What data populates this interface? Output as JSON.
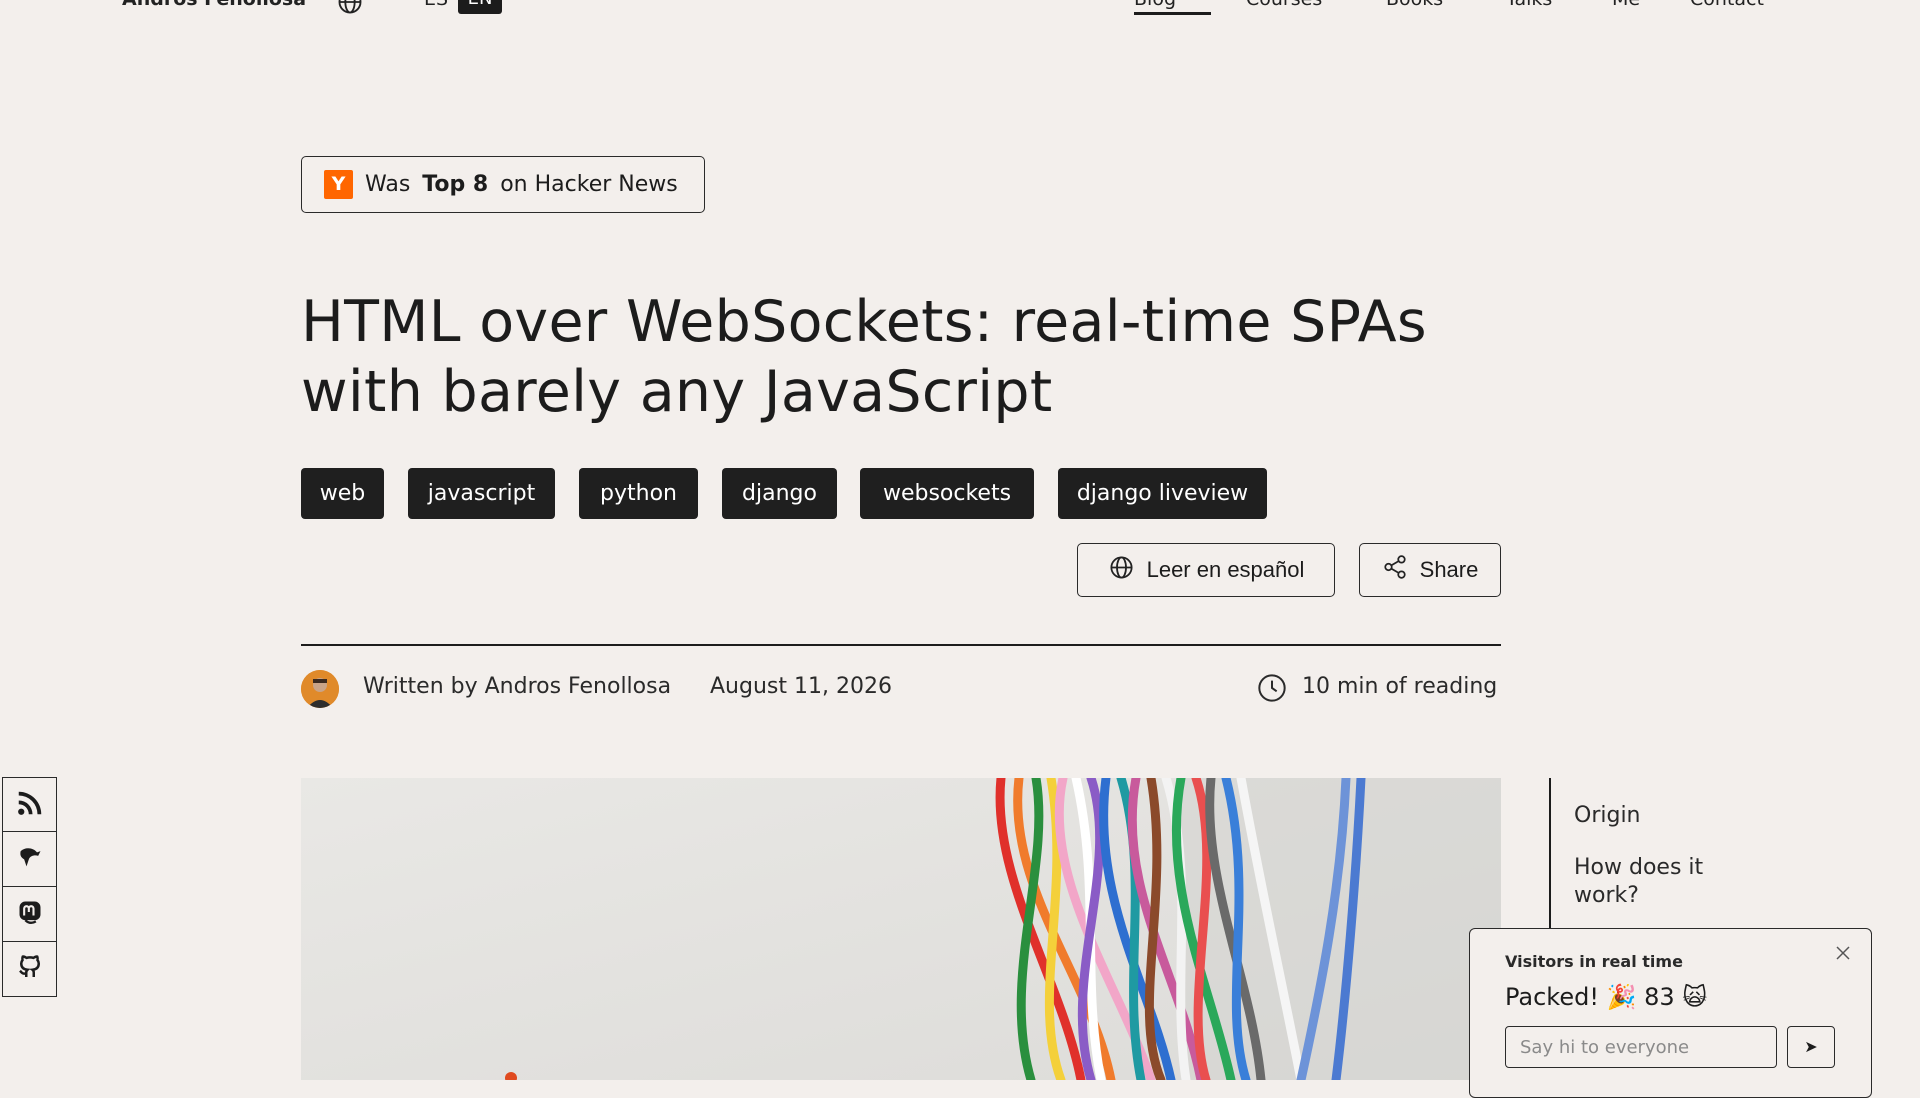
{
  "header": {
    "brand": "Andros Fenollosa",
    "lang_es": "ES",
    "lang_en": "EN",
    "nav": [
      "Blog",
      "Courses",
      "Books",
      "Talks",
      "Me",
      "Contact"
    ],
    "active_nav": "Blog"
  },
  "badge": {
    "logo": "Y",
    "prefix": "Was",
    "highlight": "Top 8",
    "suffix": "on Hacker News",
    "logo_color": "#ff6600"
  },
  "article": {
    "title": "HTML over WebSockets: real-time SPAs with barely any JavaScript",
    "tags": [
      "web",
      "javascript",
      "python",
      "django",
      "websockets",
      "django liveview"
    ],
    "read_spanish": "Leer en español",
    "share": "Share",
    "author_line": "Written by Andros Fenollosa",
    "date": "August 11, 2026",
    "reading_time": "10 min of reading"
  },
  "social": {
    "icons": [
      "rss-icon",
      "gnu-icon",
      "mastodon-icon",
      "github-icon"
    ]
  },
  "toc": {
    "items": [
      "Origin",
      "How does it work?"
    ]
  },
  "visitors": {
    "title": "Visitors in real time",
    "status": "Packed! 🎉 83 🙀",
    "input_placeholder": "Say hi to everyone",
    "send_label": "➤"
  },
  "colors": {
    "background": "#f3efec",
    "ink": "#1c1c1c",
    "hn_orange": "#ff6600"
  }
}
